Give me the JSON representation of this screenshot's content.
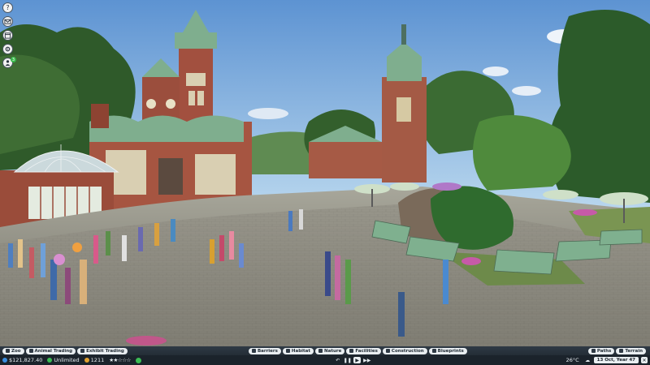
{
  "left_hud": {
    "help_glyph": "?",
    "badge_count": "3"
  },
  "toolbar": {
    "left": [
      "Zoo",
      "Animal Trading",
      "Exhibit Trading"
    ],
    "center": [
      "Barriers",
      "Habitat",
      "Nature",
      "Facilities",
      "Construction",
      "Blueprints"
    ],
    "right": [
      "Paths",
      "Terrain"
    ]
  },
  "status": {
    "money": "$121,827.40",
    "research": "Unlimited",
    "guests": "1211",
    "rating_stars": "★★☆☆☆",
    "temperature": "26°C",
    "date": "13 Oct, Year 47",
    "close_glyph": "✕"
  },
  "colors": {
    "toolbar_bg": "#2a3440",
    "pill_bg": "#e9eef1",
    "money_icon": "#3a8ee0",
    "guest_icon": "#e0a030",
    "happiness": "#3cbc54"
  }
}
